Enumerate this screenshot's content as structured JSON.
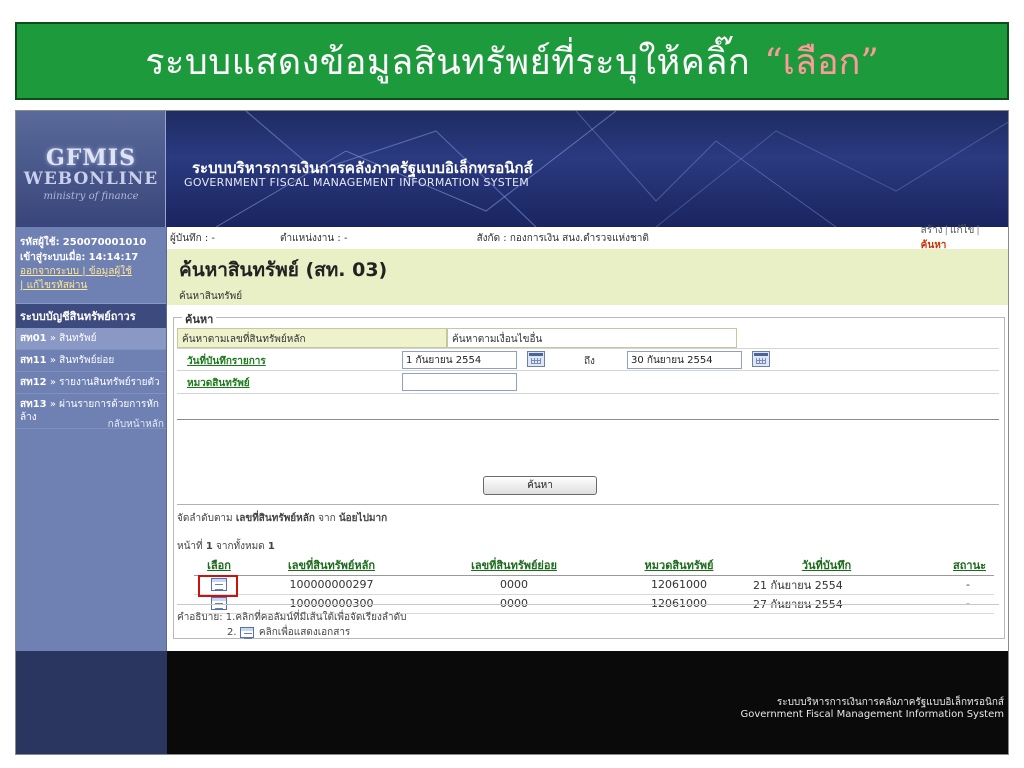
{
  "banner": {
    "title": "ระบบแสดงข้อมูลสินทรัพย์ที่ระบุให้คลิ๊ก",
    "highlight": "“เลือก”"
  },
  "header": {
    "logo_main": "GFMIS",
    "logo_sub": "WEBONLINE",
    "logo_tag": "ministry of finance",
    "system_title_th": "ระบบบริหารการเงินการคลังภาครัฐแบบอิเล็กทรอนิกส์",
    "system_title_en": "GOVERNMENT FISCAL MANAGEMENT INFORMATION SYSTEM"
  },
  "sidebar": {
    "user_id_label": "รหัสผู้ใช้:",
    "user_id": "250070001010",
    "login_label": "เข้าสู่ระบบเมื่อ:",
    "login_time": "14:14:17",
    "link_logout": "ออกจากระบบ",
    "link_userinfo": "ข้อมูลผู้ใช้",
    "link_password": "แก้ไขรหัสผ่าน",
    "menu_header": "ระบบบัญชีสินทรัพย์ถาวร",
    "items": [
      {
        "code": "สท01",
        "label": "» สินทรัพย์"
      },
      {
        "code": "สท11",
        "label": "» สินทรัพย์ย่อย"
      },
      {
        "code": "สท12",
        "label": "» รายงานสินทรัพย์รายตัว"
      },
      {
        "code": "สท13",
        "label": "» ผ่านรายการด้วยการหักล้าง"
      }
    ],
    "back_home": "กลับหน้าหลัก"
  },
  "topbar": {
    "recorder": "ผู้บันทึก : -",
    "position": "ตำแหน่งงาน : -",
    "unit": "สังกัด : กองการเงิน สนง.ตำรวจแห่งชาติ",
    "create": "สร้าง",
    "edit": "แก้ไข",
    "search": "ค้นหา"
  },
  "page": {
    "title": "ค้นหาสินทรัพย์ (สท. 03)",
    "subtitle": "ค้นหาสินทรัพย์"
  },
  "search": {
    "legend": "ค้นหา",
    "tab_main": "ค้นหาตามเลขที่สินทรัพย์หลัก",
    "tab_condition": "ค้นหาตามเงื่อนไขอื่น",
    "date_label": "วันที่บันทึกรายการ",
    "date_from": "1 กันยายน 2554",
    "to_label": "ถึง",
    "date_to": "30 กันยายน 2554",
    "category_label": "หมวดสินทรัพย์",
    "category_value": "",
    "button": "ค้นหา"
  },
  "results": {
    "sort_prefix": "จัดลำดับตาม",
    "sort_field": "เลขที่สินทรัพย์หลัก",
    "sort_from": "จาก",
    "sort_order": "น้อยไปมาก",
    "page_prefix": "หน้าที่",
    "page_current": "1",
    "page_mid": "จากทั้งหมด",
    "page_total": "1",
    "columns": [
      "เลือก",
      "เลขที่สินทรัพย์หลัก",
      "เลขที่สินทรัพย์ย่อย",
      "หมวดสินทรัพย์",
      "วันที่บันทึก",
      "สถานะ"
    ],
    "rows": [
      {
        "main": "100000000297",
        "sub": "0000",
        "category": "12061000",
        "date": "21 กันยายน 2554",
        "status": "-"
      },
      {
        "main": "100000000300",
        "sub": "0000",
        "category": "12061000",
        "date": "27 กันยายน 2554",
        "status": "-"
      }
    ],
    "note1": "คำอธิบาย:  1.คลิกที่คอลัมน์ที่มีเส้นใต้เพื่อจัดเรียงลำดับ",
    "note2_num": "2.",
    "note2": "คลิกเพื่อแสดงเอกสาร"
  },
  "footer": {
    "th": "ระบบบริหารการเงินการคลังภาครัฐแบบอิเล็กทรอนิกส์",
    "en": "Government Fiscal Management Information System"
  }
}
